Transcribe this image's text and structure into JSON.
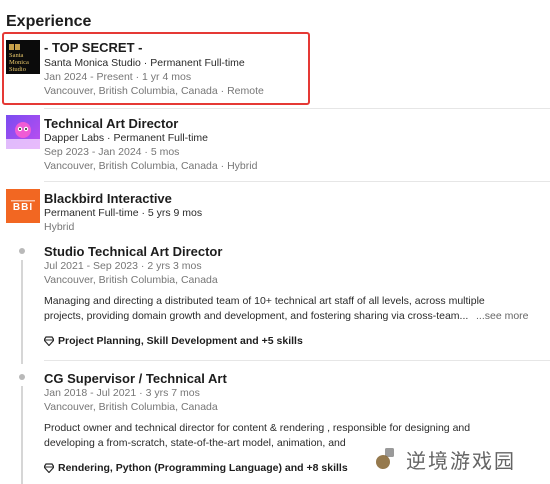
{
  "section": {
    "title": "Experience"
  },
  "jobs": [
    {
      "role": "- TOP SECRET -",
      "company_type": "Santa Monica Studio · Permanent Full-time",
      "dates": "Jan 2024 - Present · 1 yr 4 mos",
      "location": "Vancouver, British Columbia, Canada · Remote",
      "logo_text": "Santa Monica Studio",
      "logo_icon": "santa-monica-studio-logo"
    },
    {
      "role": "Technical Art Director",
      "company_type": "Dapper Labs · Permanent Full-time",
      "dates": "Sep 2023 - Jan 2024 · 5 mos",
      "location": "Vancouver, British Columbia, Canada · Hybrid",
      "logo_icon": "dapper-labs-logo"
    }
  ],
  "company_group": {
    "name": "Blackbird Interactive",
    "type_duration": "Permanent Full-time · 5 yrs 9 mos",
    "work_mode": "Hybrid",
    "logo_text": "BBI",
    "positions": [
      {
        "role": "Studio Technical Art Director",
        "dates": "Jul 2021 - Sep 2023 · 2 yrs 3 mos",
        "location": "Vancouver, British Columbia, Canada",
        "description": "Managing and directing a distributed team of 10+ technical art staff of all levels, across multiple projects, providing domain growth and development, and fostering sharing via cross-team...",
        "see_more": "...see more",
        "skills": "Project Planning, Skill Development and +5 skills"
      },
      {
        "role": "CG Supervisor / Technical Art",
        "dates": "Jan 2018 - Jul 2021 · 3 yrs 7 mos",
        "location": "Vancouver, British Columbia, Canada",
        "description": "Product owner and technical director for content & rendering , responsible for designing and developing a from-scratch, state-of-the-art model, animation, and",
        "skills": "Rendering, Python (Programming Language) and +8 skills"
      }
    ]
  },
  "watermark": {
    "text": "逆境游戏园"
  },
  "colors": {
    "highlight": "#e53935",
    "bbi_orange": "#f26722",
    "dapper_purple": "#8e44ec"
  }
}
